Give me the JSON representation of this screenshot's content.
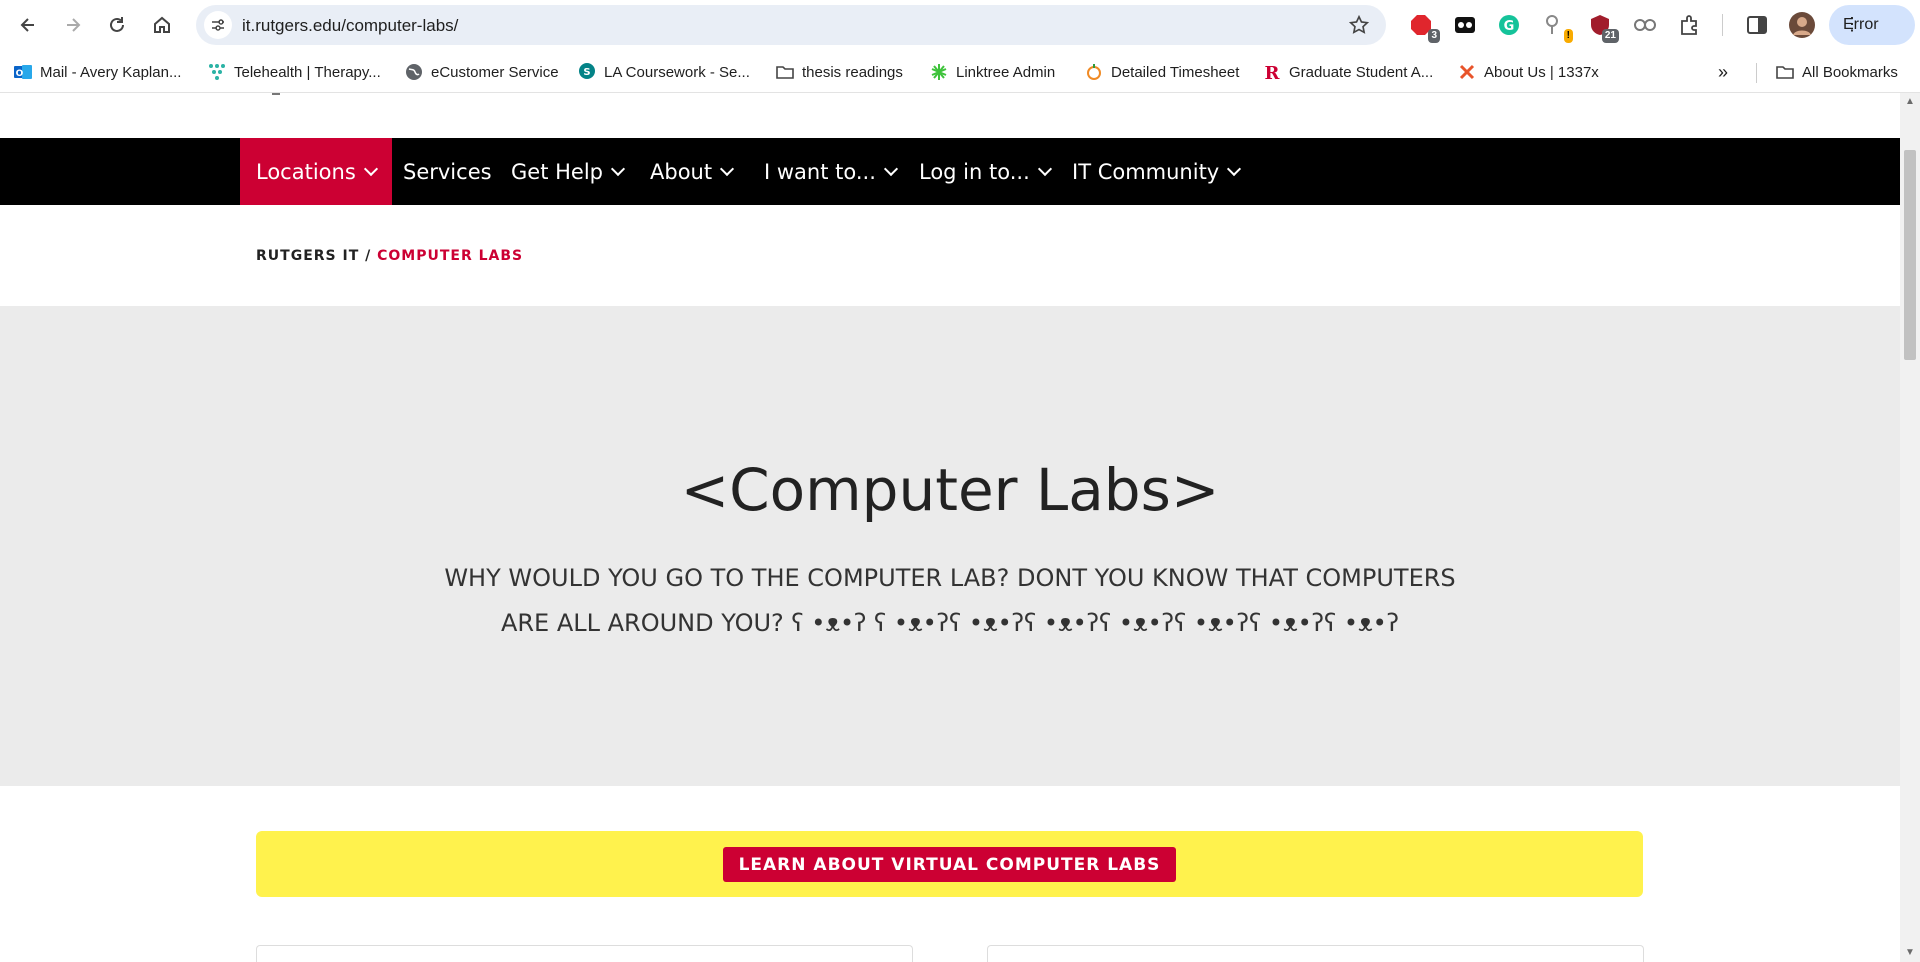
{
  "browser": {
    "url": "it.rutgers.edu/computer-labs/",
    "profile_status": "Error",
    "extensions": [
      {
        "name": "adblock-icon",
        "badge": "3"
      },
      {
        "name": "mask-icon",
        "badge": ""
      },
      {
        "name": "grammarly-icon",
        "badge": ""
      },
      {
        "name": "password-icon",
        "badge": "!"
      },
      {
        "name": "shield-icon",
        "badge": "21"
      },
      {
        "name": "link-icon",
        "badge": ""
      },
      {
        "name": "puzzle-icon",
        "badge": ""
      }
    ],
    "bookmarks": [
      {
        "label": "Mail - Avery Kaplan...",
        "icon": "outlook-icon",
        "color": "#0a64c8"
      },
      {
        "label": "Telehealth | Therapy...",
        "icon": "dots-icon",
        "color": "#2bb3a5"
      },
      {
        "label": "eCustomer Service",
        "icon": "globe-icon",
        "color": "#5f6368"
      },
      {
        "label": "LA Coursework - Se...",
        "icon": "sharepoint-icon",
        "color": "#038387"
      },
      {
        "label": "thesis readings",
        "icon": "folder-icon",
        "color": "#5f6368"
      },
      {
        "label": "Linktree Admin",
        "icon": "linktree-icon",
        "color": "#3ec33b"
      },
      {
        "label": "Detailed Timesheet",
        "icon": "timesheet-icon",
        "color": "#f08a24"
      },
      {
        "label": "Graduate Student A...",
        "icon": "rutgers-r-icon",
        "color": "#cc0033"
      },
      {
        "label": "About Us | 1337x",
        "icon": "x-icon",
        "color": "#e8542a"
      }
    ],
    "all_bookmarks": "All Bookmarks"
  },
  "site": {
    "nav": [
      "Locations",
      "Services",
      "Get Help",
      "About",
      "I want to...",
      "Log in to...",
      "IT Community"
    ],
    "breadcrumb_home": "RUTGERS IT",
    "breadcrumb_sep": " / ",
    "breadcrumb_current": "COMPUTER LABS",
    "hero_title": "<Computer Labs>",
    "hero_subtitle": "WHY WOULD YOU GO TO THE COMPUTER LAB? DONT YOU KNOW THAT COMPUTERS ARE ALL AROUND YOU? ʕ •ᴥ•ʔ ʕ •ᴥ•ʔʕ •ᴥ•ʔʕ •ᴥ•ʔʕ •ᴥ•ʔʕ •ᴥ•ʔʕ •ᴥ•ʔʕ •ᴥ•ʔ",
    "callout_button": "LEARN ABOUT VIRTUAL COMPUTER LABS"
  },
  "colors": {
    "brand_red": "#cc0033",
    "nav_bg": "#000000",
    "hero_bg": "#ebebeb",
    "callout_bg": "#fff24d"
  }
}
